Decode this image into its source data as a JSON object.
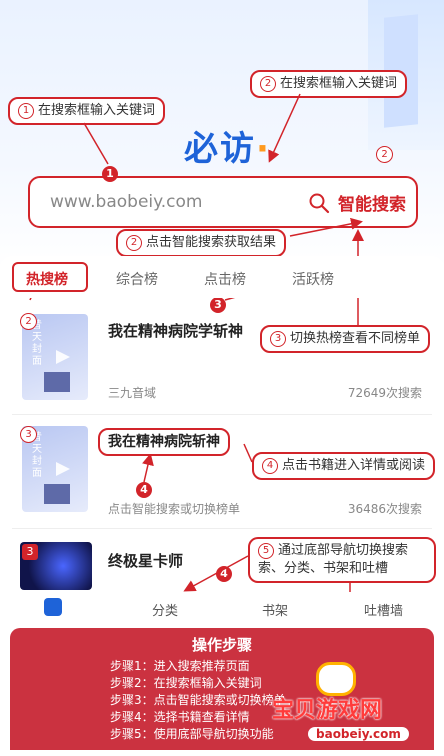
{
  "header": {
    "logo_text": "必访"
  },
  "search": {
    "placeholder": "www.baobeiy.com",
    "button_label": "智能搜索"
  },
  "callouts": {
    "c1": {
      "num": "1",
      "text": "在搜索框输入关键词"
    },
    "c2": {
      "num": "2",
      "text": "在搜索框输入关键词"
    },
    "c3": {
      "num": "2",
      "text": "点击智能搜索获取结果"
    },
    "c4": {
      "num": "3",
      "text": "切换热榜查看不同榜单"
    },
    "c5": {
      "num": "4",
      "text": "点击书籍进入详情或阅读"
    },
    "c6": {
      "num": "5",
      "text": "通过底部导航切换搜索索、分类、书架和吐槽"
    }
  },
  "markers": [
    "1",
    "2",
    "3",
    "4",
    "4",
    "5",
    "2",
    "3",
    "3"
  ],
  "tabs": [
    "热搜榜",
    "综合榜",
    "点击榜",
    "活跃榜"
  ],
  "books": [
    {
      "rank": "2",
      "cover_text": "昔天封面",
      "title": "我在精神病院学斩神",
      "meta_left": "三九音域",
      "meta_right": "72649次搜索"
    },
    {
      "rank": "3",
      "cover_text": "昔天封面",
      "title": "我在精神病院斩神",
      "meta_left": "点击智能搜索或切换榜单",
      "meta_right": "36486次搜索"
    },
    {
      "rank": "3",
      "title": "终极星卡师"
    }
  ],
  "nav": [
    "分类",
    "书架",
    "吐槽墙"
  ],
  "steps": {
    "title": "操作步骤",
    "items": [
      "步骤1：进入搜索推荐页面",
      "步骤2：在搜索框输入关键词",
      "步骤3：点击智能搜索或切换榜单",
      "步骤4：选择书籍查看详情",
      "步骤5：使用底部导航切换功能"
    ]
  },
  "watermark": {
    "text": "宝贝游戏网",
    "url": "baobeiy.com"
  },
  "colors": {
    "accent": "#d2242a",
    "brand": "#1e63d8"
  }
}
